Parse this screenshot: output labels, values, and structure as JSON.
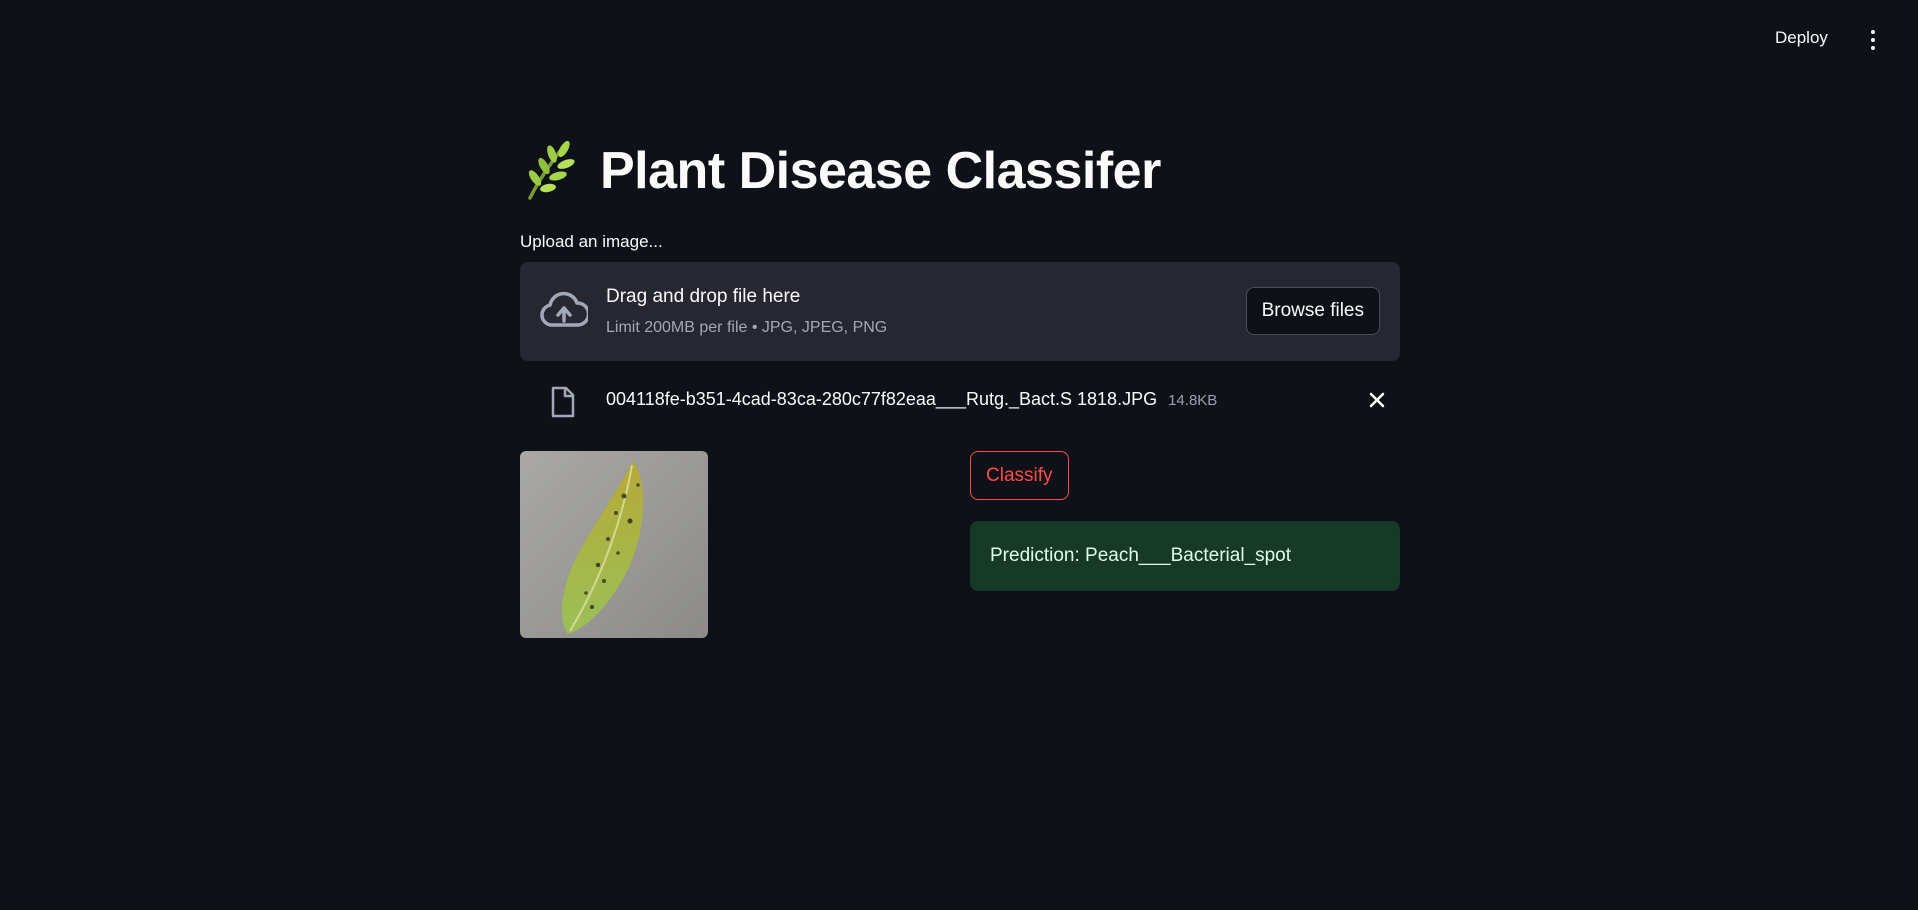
{
  "header": {
    "deploy_label": "Deploy",
    "menu_icon": "more-vertical-icon"
  },
  "main": {
    "title": "Plant Disease Classifer",
    "title_icon": "herb-icon",
    "uploader": {
      "label": "Upload an image...",
      "drop_title": "Drag and drop file here",
      "drop_subtitle": "Limit 200MB per file • JPG, JPEG, PNG",
      "browse_label": "Browse files",
      "upload_icon": "cloud-upload-icon"
    },
    "uploaded_file": {
      "name": "004118fe-b351-4cad-83ca-280c77f82eaa___Rutg._Bact.S 1818.JPG",
      "size": "14.8KB",
      "file_icon": "file-icon",
      "remove_icon": "close-icon"
    },
    "classify_label": "Classify",
    "prediction_text": "Prediction: Peach___Bacterial_spot"
  },
  "colors": {
    "background": "#0e1117",
    "panel": "#262730",
    "accent": "#ff4b4b",
    "success_bg": "#173928",
    "success_text": "#dffde9"
  }
}
